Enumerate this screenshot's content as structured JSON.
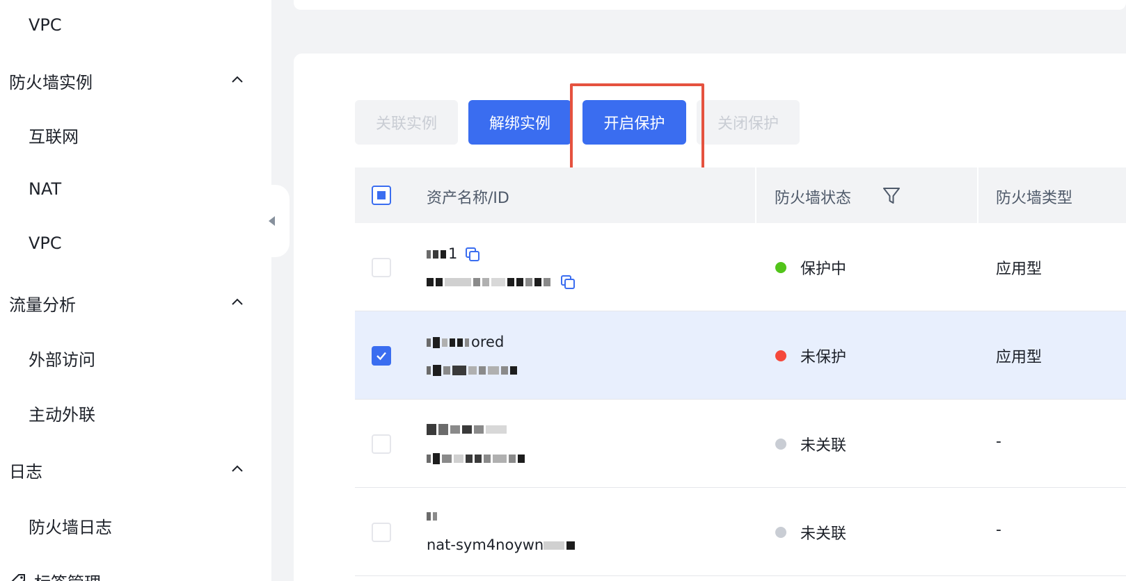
{
  "sidebar": {
    "items": [
      {
        "label": "VPC",
        "kind": "sub"
      },
      {
        "label": "防火墙实例",
        "kind": "group"
      },
      {
        "label": "互联网",
        "kind": "sub"
      },
      {
        "label": "NAT",
        "kind": "sub"
      },
      {
        "label": "VPC",
        "kind": "sub"
      },
      {
        "label": "流量分析",
        "kind": "group"
      },
      {
        "label": "外部访问",
        "kind": "sub"
      },
      {
        "label": "主动外联",
        "kind": "sub"
      },
      {
        "label": "日志",
        "kind": "group"
      },
      {
        "label": "防火墙日志",
        "kind": "sub"
      },
      {
        "label": "标签管理",
        "kind": "group-icon"
      }
    ]
  },
  "toolbar": {
    "associate_label": "关联实例",
    "unbind_label": "解绑实例",
    "enable_label": "开启保护",
    "disable_label": "关闭保护"
  },
  "table": {
    "headers": {
      "asset": "资产名称/ID",
      "status": "防火墙状态",
      "type": "防火墙类型"
    },
    "rows": [
      {
        "name": "1",
        "id": "",
        "status": "保护中",
        "status_color": "#52c41a",
        "type": "应用型",
        "selected": false
      },
      {
        "name": "ored",
        "id": "",
        "status": "未保护",
        "status_color": "#f5483b",
        "type": "应用型",
        "selected": true
      },
      {
        "name": "",
        "id": "",
        "status": "未关联",
        "status_color": "#c9cdd4",
        "type": "-",
        "selected": false
      },
      {
        "name": "",
        "id": "nat-sym4noywn",
        "status": "未关联",
        "status_color": "#c9cdd4",
        "type": "-",
        "selected": false
      }
    ]
  },
  "colors": {
    "primary": "#3a6df0",
    "highlight": "#e5523f",
    "selected_row": "#e8effd"
  }
}
